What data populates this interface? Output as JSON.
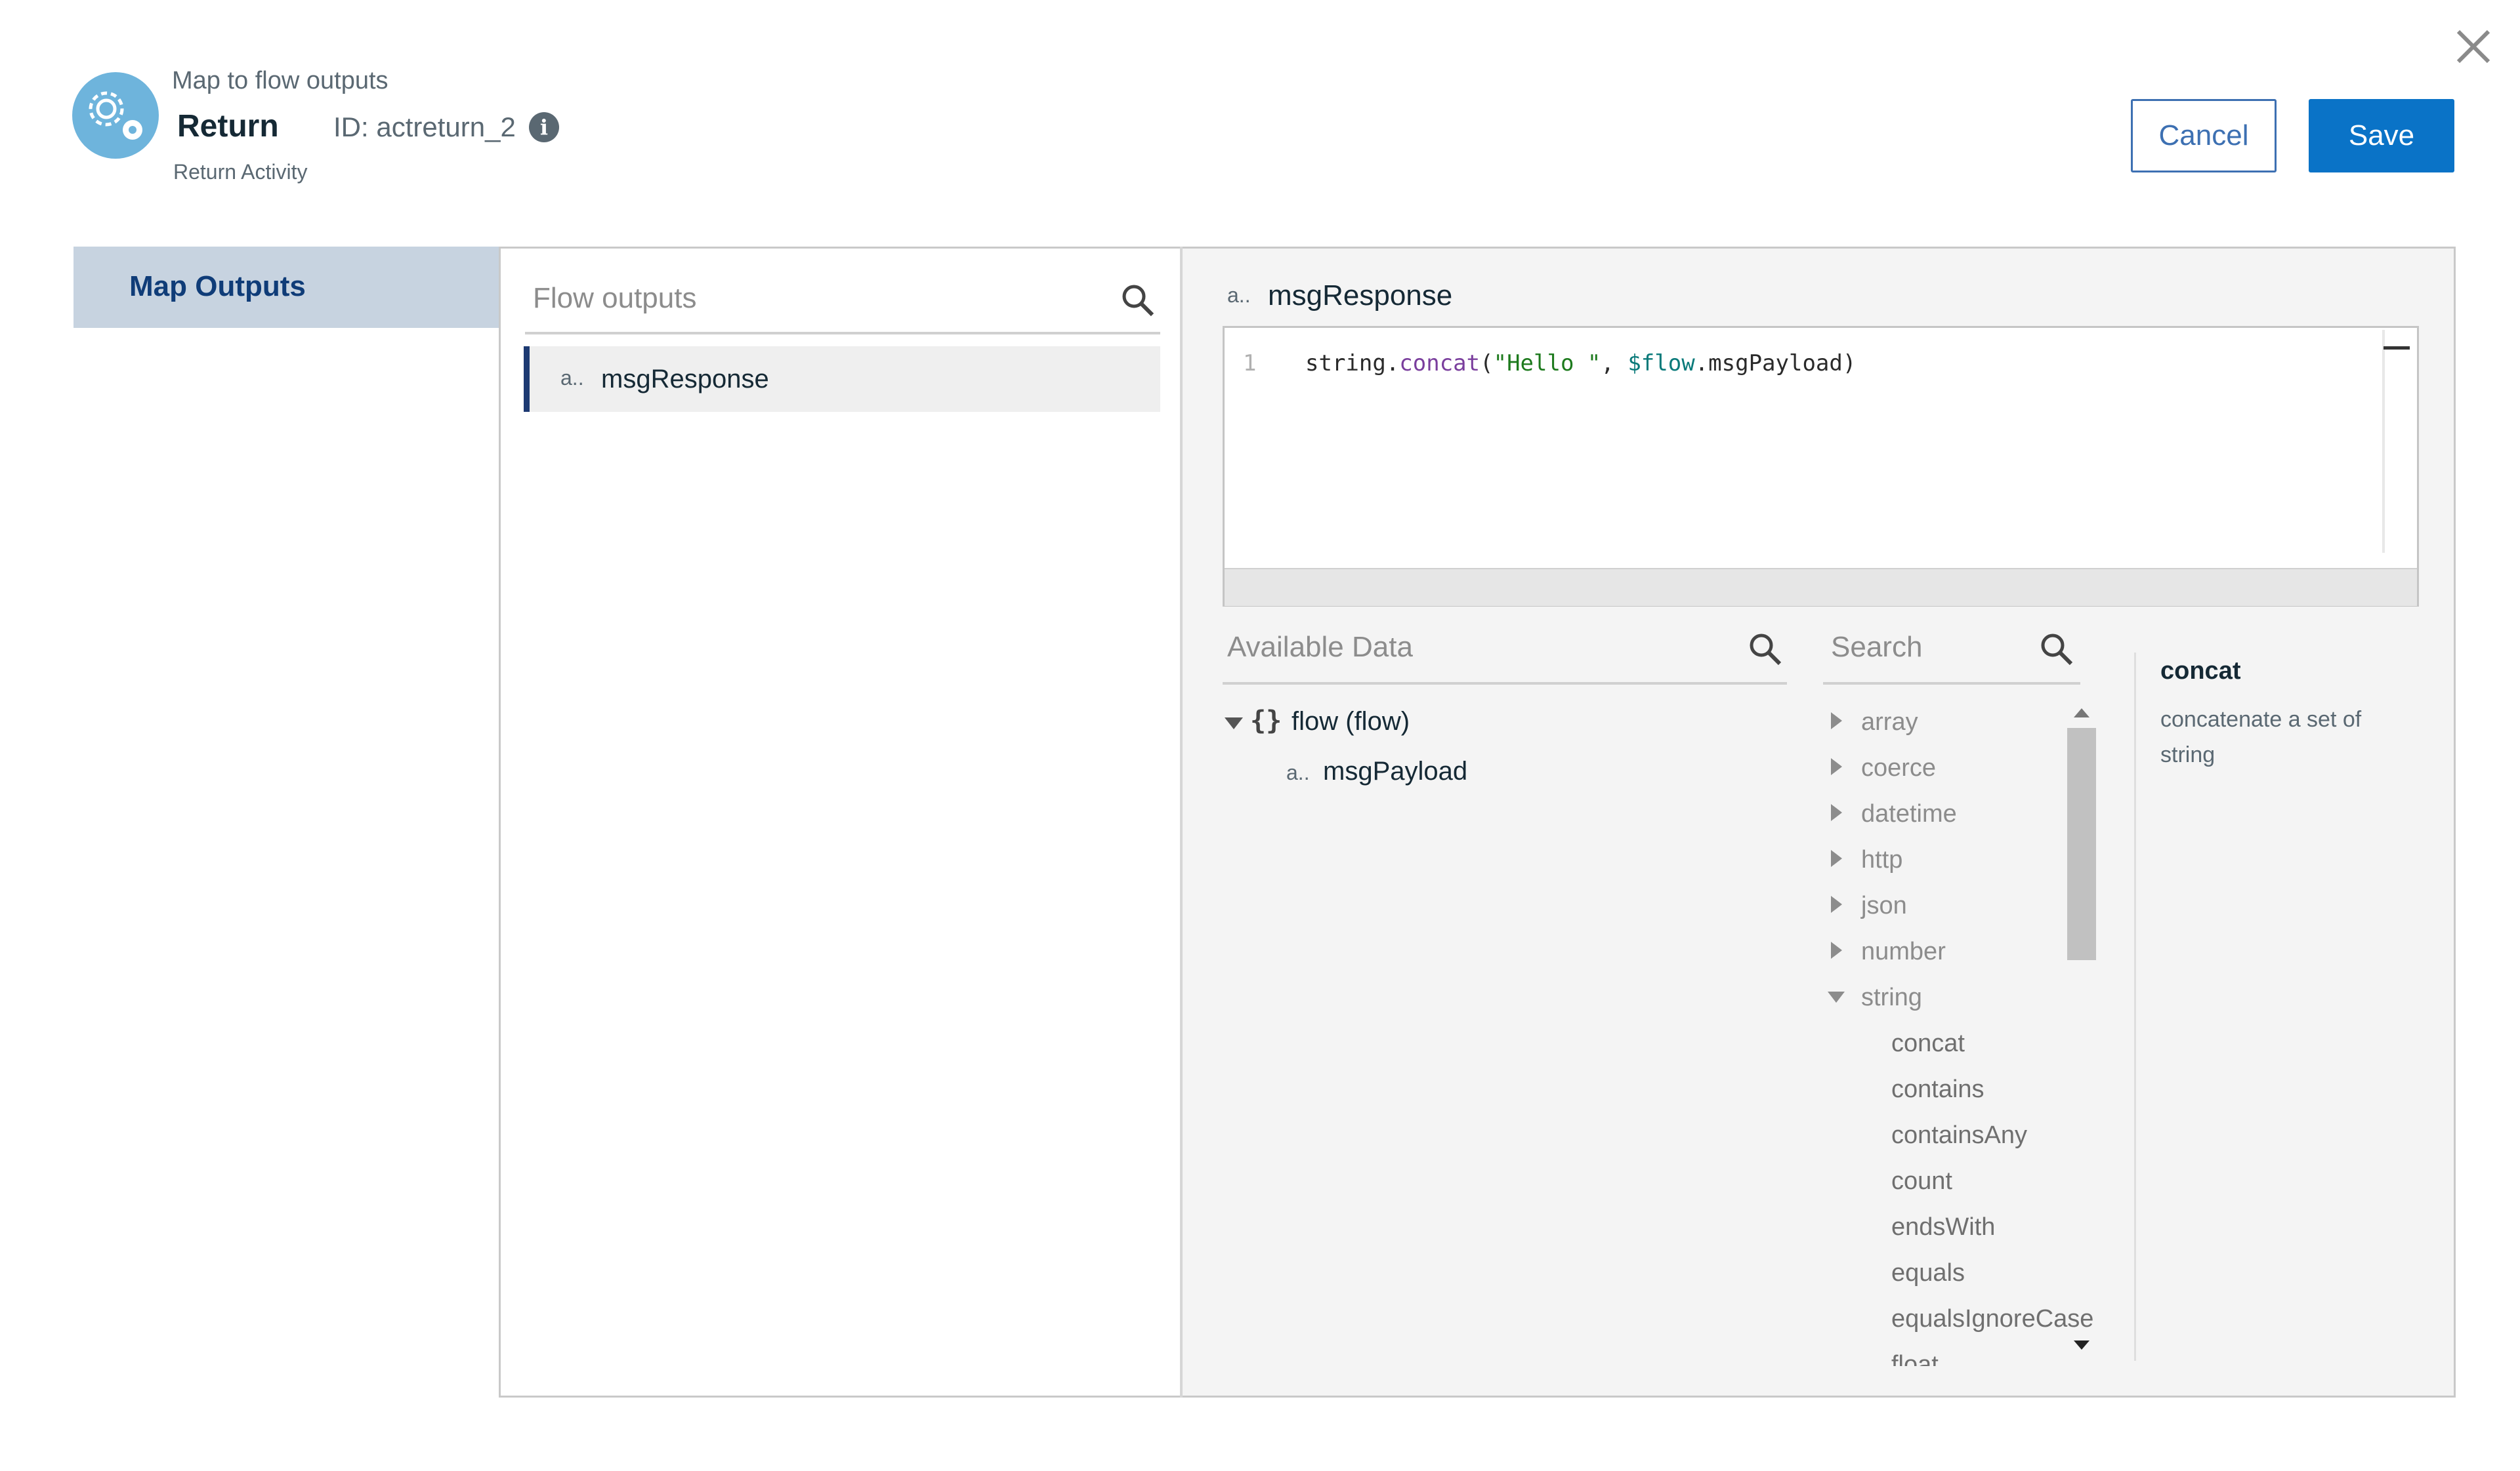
{
  "header": {
    "subtitle": "Map to flow outputs",
    "title": "Return",
    "id_label": "ID: actreturn_2",
    "info_glyph": "i",
    "caption": "Return Activity",
    "icon": "gear-icon",
    "icon_color": "#6eb4dc"
  },
  "actions": {
    "cancel_label": "Cancel",
    "save_label": "Save",
    "accent_color": "#0a73c7"
  },
  "nav": {
    "items": [
      {
        "label": "Map Outputs",
        "selected": true
      }
    ]
  },
  "flow_outputs": {
    "placeholder": "Flow outputs",
    "items": [
      {
        "type_badge": "a..",
        "label": "msgResponse",
        "selected": true
      }
    ]
  },
  "editor": {
    "type_badge": "a..",
    "field_name": "msgResponse",
    "line_number": "1",
    "code_tokens": {
      "object": "string.",
      "function": "concat",
      "open": "(",
      "string_literal": "\"Hello \"",
      "comma": ", ",
      "variable": "$flow",
      "rest": ".msgPayload)"
    }
  },
  "available_data": {
    "placeholder": "Available Data",
    "root": {
      "icon": "{}",
      "label": "flow (flow)",
      "expanded": true
    },
    "children": [
      {
        "type_badge": "a..",
        "label": "msgPayload"
      }
    ]
  },
  "functions": {
    "placeholder": "Search",
    "categories": [
      {
        "label": "array",
        "expanded": false
      },
      {
        "label": "coerce",
        "expanded": false
      },
      {
        "label": "datetime",
        "expanded": false
      },
      {
        "label": "http",
        "expanded": false
      },
      {
        "label": "json",
        "expanded": false
      },
      {
        "label": "number",
        "expanded": false
      },
      {
        "label": "string",
        "expanded": true
      }
    ],
    "string_functions": [
      "concat",
      "contains",
      "containsAny",
      "count",
      "endsWith",
      "equals",
      "equalsIgnoreCase",
      "float"
    ]
  },
  "description": {
    "title": "concat",
    "text": "concatenate a set of string"
  }
}
